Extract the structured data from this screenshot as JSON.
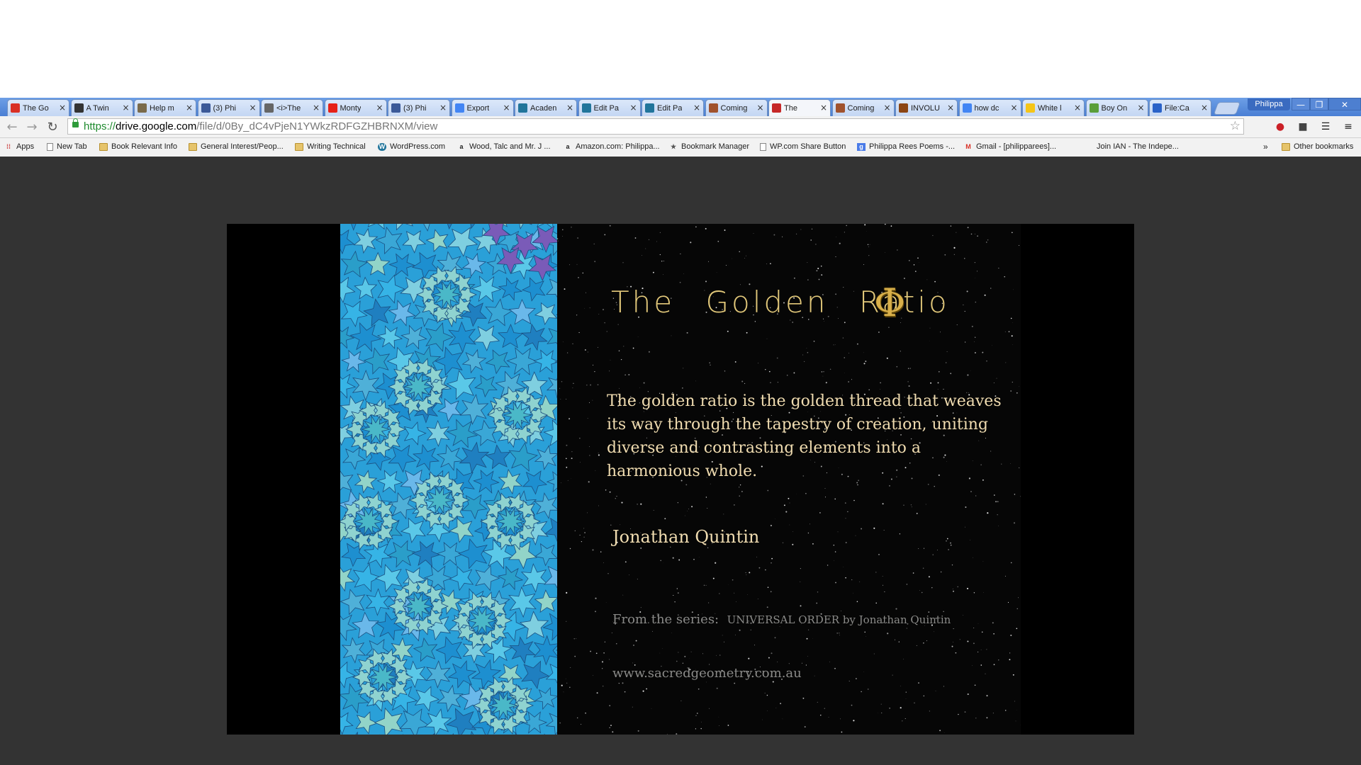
{
  "tabs": [
    {
      "title": "The Go",
      "favicon": "gmail-icon",
      "color": "#d93025"
    },
    {
      "title": "A Twin",
      "favicon": "person-icon",
      "color": "#333333"
    },
    {
      "title": "Help m",
      "favicon": "avatar-icon",
      "color": "#7a6a4a"
    },
    {
      "title": "(3) Phi",
      "favicon": "facebook-icon",
      "color": "#3b5998"
    },
    {
      "title": "<i>The",
      "favicon": "eww-icon",
      "color": "#666666"
    },
    {
      "title": "Monty",
      "favicon": "youtube-icon",
      "color": "#e62117"
    },
    {
      "title": "(3) Phi",
      "favicon": "facebook-icon",
      "color": "#3b5998"
    },
    {
      "title": "Export",
      "favicon": "google-icon",
      "color": "#4285f4"
    },
    {
      "title": "Acaden",
      "favicon": "wordpress-icon",
      "color": "#21759b"
    },
    {
      "title": "Edit Pa",
      "favicon": "wordpress-icon",
      "color": "#21759b"
    },
    {
      "title": "Edit Pa",
      "favicon": "wordpress-icon",
      "color": "#21759b"
    },
    {
      "title": "Coming",
      "favicon": "site-icon",
      "color": "#a0522d"
    },
    {
      "title": "The",
      "favicon": "calendar-icon",
      "color": "#c62828",
      "active": true
    },
    {
      "title": "Coming",
      "favicon": "site-icon",
      "color": "#a0522d"
    },
    {
      "title": "INVOLU",
      "favicon": "site-icon",
      "color": "#8b4513"
    },
    {
      "title": "how dc",
      "favicon": "google-icon",
      "color": "#4285f4"
    },
    {
      "title": "White l",
      "favicon": "imdb-icon",
      "color": "#f5c518"
    },
    {
      "title": "Boy On",
      "favicon": "goodreads-icon",
      "color": "#5a9e3a"
    },
    {
      "title": "File:Ca",
      "favicon": "wiki-icon",
      "color": "#2a62c8"
    }
  ],
  "profile_name": "Philippa",
  "window_controls": {
    "minimize": "—",
    "restore": "❐",
    "close": "✕"
  },
  "address": {
    "scheme": "https://",
    "host": "drive.google.com",
    "path": "/file/d/0By_dC4vPjeN1YWkzRDFGZHBRNXM/view"
  },
  "bookmarks": [
    {
      "label": "Apps",
      "icon": "apps-icon"
    },
    {
      "label": "New Tab",
      "icon": "page-icon"
    },
    {
      "label": "Book Relevant Info",
      "icon": "folder-icon"
    },
    {
      "label": "General Interest/Peop...",
      "icon": "folder-icon"
    },
    {
      "label": "Writing Technical",
      "icon": "folder-icon"
    },
    {
      "label": "WordPress.com",
      "icon": "wordpress-icon"
    },
    {
      "label": "Wood, Talc and Mr. J ...",
      "icon": "amazon-icon"
    },
    {
      "label": "Amazon.com: Philippa...",
      "icon": "amazon-icon"
    },
    {
      "label": "Bookmark Manager",
      "icon": "star-icon"
    },
    {
      "label": "WP.com Share Button",
      "icon": "page-icon"
    },
    {
      "label": "Philippa Rees Poems -...",
      "icon": "google-plus-icon"
    },
    {
      "label": "Gmail - [philipparees]...",
      "icon": "gmail-icon"
    },
    {
      "label": "Join IAN - The Indepe...",
      "icon": "blank-icon"
    }
  ],
  "bookmarks_overflow": "»",
  "other_bookmarks": "Other bookmarks",
  "slide": {
    "title": "The Golden Ratio",
    "symbol": "Φ",
    "quote": "The golden ratio is the golden thread that weaves its way through the tapestry of  creation, uniting diverse and contrasting elements into a harmonious whole.",
    "author": "Jonathan Quintin",
    "series_prefix": "From the series:",
    "series_name": "UNIVERSAL ORDER by Jonathan Quintin",
    "website": "www.sacredgeometry.com.au"
  },
  "colors": {
    "viewer_bg": "#333333",
    "slide_text": "#f0dcb0",
    "title_gold": "#e2c87a",
    "muted": "#8a8a88"
  }
}
